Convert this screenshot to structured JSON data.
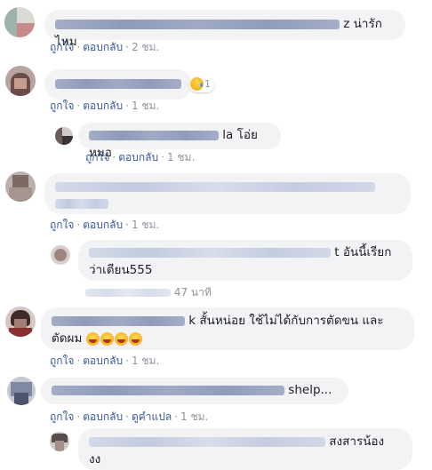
{
  "actions": {
    "like": "ถูกใจ",
    "reply": "ตอบกลับ",
    "translate": "ดูคำแปล",
    "sep": "·"
  },
  "comments": [
    {
      "visible_text": "z น่ารักไหม",
      "time": "2 ชม."
    },
    {
      "reaction_count": "1",
      "time": "1 ชม."
    },
    {
      "visible_text": "la โอ่ยหมอ",
      "time": "1 ชม."
    },
    {
      "time": "1 ชม."
    },
    {
      "visible_text_line1": "t อันนี้เรียก",
      "visible_text_line2": "ว่าเตียน555",
      "time": "47 นาที"
    },
    {
      "visible_text_line1": "k สั้นหน่อย ใช้ไม่ได้กับการตัดขน และ",
      "visible_text_line2": "ตัดผม",
      "time": "1 ชม."
    },
    {
      "visible_text": "shelp...",
      "time": "1 ชม."
    },
    {
      "visible_text_line1": "สงสารน้อง",
      "visible_text_line2": "งง"
    }
  ],
  "colors": {
    "link": "#385898",
    "meta": "#90949c",
    "bubble": "#f2f3f5"
  }
}
